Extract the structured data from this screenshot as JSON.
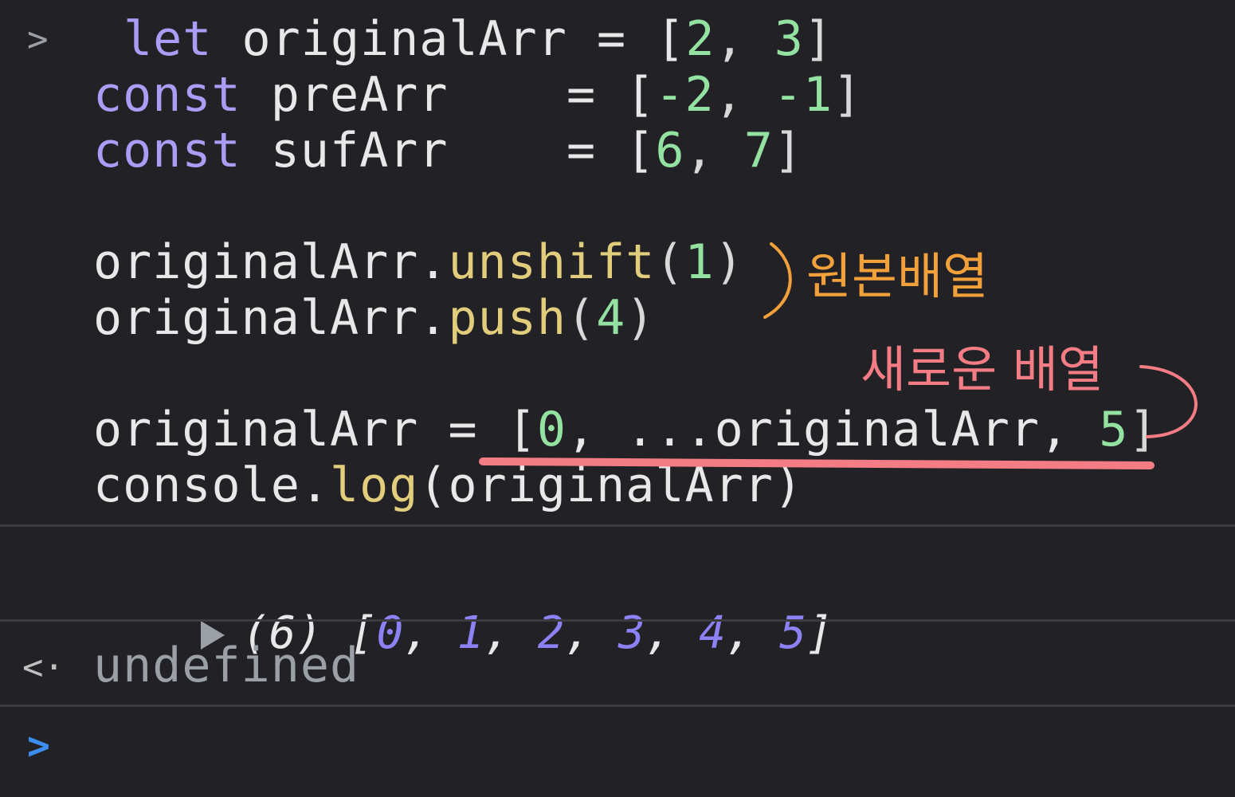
{
  "console": {
    "prompt_symbol": ">",
    "input_lines": [
      {
        "tokens": [
          {
            "t": "let",
            "c": "kw"
          },
          {
            "t": " originalArr = [",
            "c": "ident"
          },
          {
            "t": "2",
            "c": "num"
          },
          {
            "t": ", ",
            "c": "punct"
          },
          {
            "t": "3",
            "c": "num"
          },
          {
            "t": "]",
            "c": "punct"
          }
        ]
      },
      {
        "tokens": [
          {
            "t": "const",
            "c": "kw"
          },
          {
            "t": " preArr    = [",
            "c": "ident"
          },
          {
            "t": "-2",
            "c": "num"
          },
          {
            "t": ", ",
            "c": "punct"
          },
          {
            "t": "-1",
            "c": "num"
          },
          {
            "t": "]",
            "c": "punct"
          }
        ]
      },
      {
        "tokens": [
          {
            "t": "const",
            "c": "kw"
          },
          {
            "t": " sufArr    = [",
            "c": "ident"
          },
          {
            "t": "6",
            "c": "num"
          },
          {
            "t": ", ",
            "c": "punct"
          },
          {
            "t": "7",
            "c": "num"
          },
          {
            "t": "]",
            "c": "punct"
          }
        ]
      },
      {
        "tokens": [
          {
            "t": "",
            "c": "ident"
          }
        ]
      },
      {
        "tokens": [
          {
            "t": "originalArr.",
            "c": "ident"
          },
          {
            "t": "unshift",
            "c": "method"
          },
          {
            "t": "(",
            "c": "punct"
          },
          {
            "t": "1",
            "c": "num"
          },
          {
            "t": ")",
            "c": "punct"
          }
        ]
      },
      {
        "tokens": [
          {
            "t": "originalArr.",
            "c": "ident"
          },
          {
            "t": "push",
            "c": "method"
          },
          {
            "t": "(",
            "c": "punct"
          },
          {
            "t": "4",
            "c": "num"
          },
          {
            "t": ")",
            "c": "punct"
          }
        ]
      },
      {
        "tokens": [
          {
            "t": "",
            "c": "ident"
          }
        ]
      },
      {
        "tokens": [
          {
            "t": "originalArr = [",
            "c": "ident"
          },
          {
            "t": "0",
            "c": "num"
          },
          {
            "t": ", ...originalArr, ",
            "c": "ident"
          },
          {
            "t": "5",
            "c": "num"
          },
          {
            "t": "]",
            "c": "punct"
          }
        ]
      },
      {
        "tokens": [
          {
            "t": "console.",
            "c": "ident"
          },
          {
            "t": "log",
            "c": "method"
          },
          {
            "t": "(originalArr)",
            "c": "ident"
          }
        ]
      }
    ],
    "result": {
      "length_label": "(6)",
      "open": " [",
      "values": [
        "0",
        "1",
        "2",
        "3",
        "4",
        "5"
      ],
      "separator": ", ",
      "close": "]"
    },
    "return_symbol": "<·",
    "return_value": "undefined",
    "input_prompt": ">"
  },
  "annotations": {
    "original_array_label": "원본배열",
    "new_array_label": "새로운 배열",
    "orange_color": "#f2a03a",
    "pink_color": "#f47c84"
  }
}
